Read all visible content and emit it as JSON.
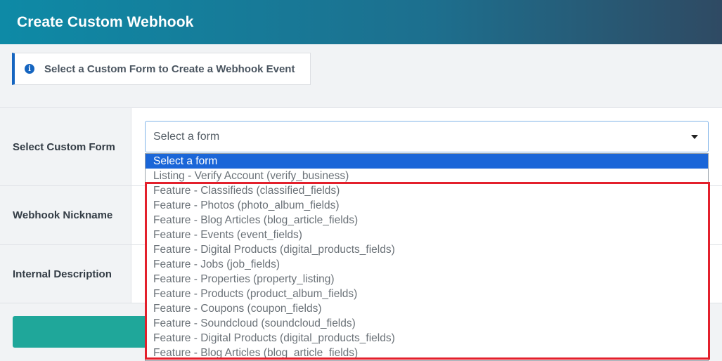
{
  "header": {
    "title": "Create Custom Webhook"
  },
  "notice": {
    "icon": "info-icon",
    "text": "Select a Custom Form to Create a Webhook Event"
  },
  "form": {
    "rows": [
      {
        "label": "Select Custom Form"
      },
      {
        "label": "Webhook Nickname"
      },
      {
        "label": "Internal Description"
      }
    ],
    "select": {
      "value": "Select a form"
    }
  },
  "dropdown": {
    "options": [
      "Select a form",
      "Listing - Verify Account (verify_business)",
      "Feature - Classifieds (classified_fields)",
      "Feature - Photos (photo_album_fields)",
      "Feature - Blog Articles (blog_article_fields)",
      "Feature - Events (event_fields)",
      "Feature - Digital Products (digital_products_fields)",
      "Feature - Jobs (job_fields)",
      "Feature - Properties (property_listing)",
      "Feature - Products (product_album_fields)",
      "Feature - Coupons (coupon_fields)",
      "Feature - Soundcloud (soundcloud_fields)",
      "Feature - Digital Products (digital_products_fields)",
      "Feature - Blog Articles (blog_article_fields)"
    ],
    "selected_index": 0
  },
  "colors": {
    "accent": "#1a66d8",
    "highlight": "#e3202c",
    "submit": "#1fa79a"
  }
}
